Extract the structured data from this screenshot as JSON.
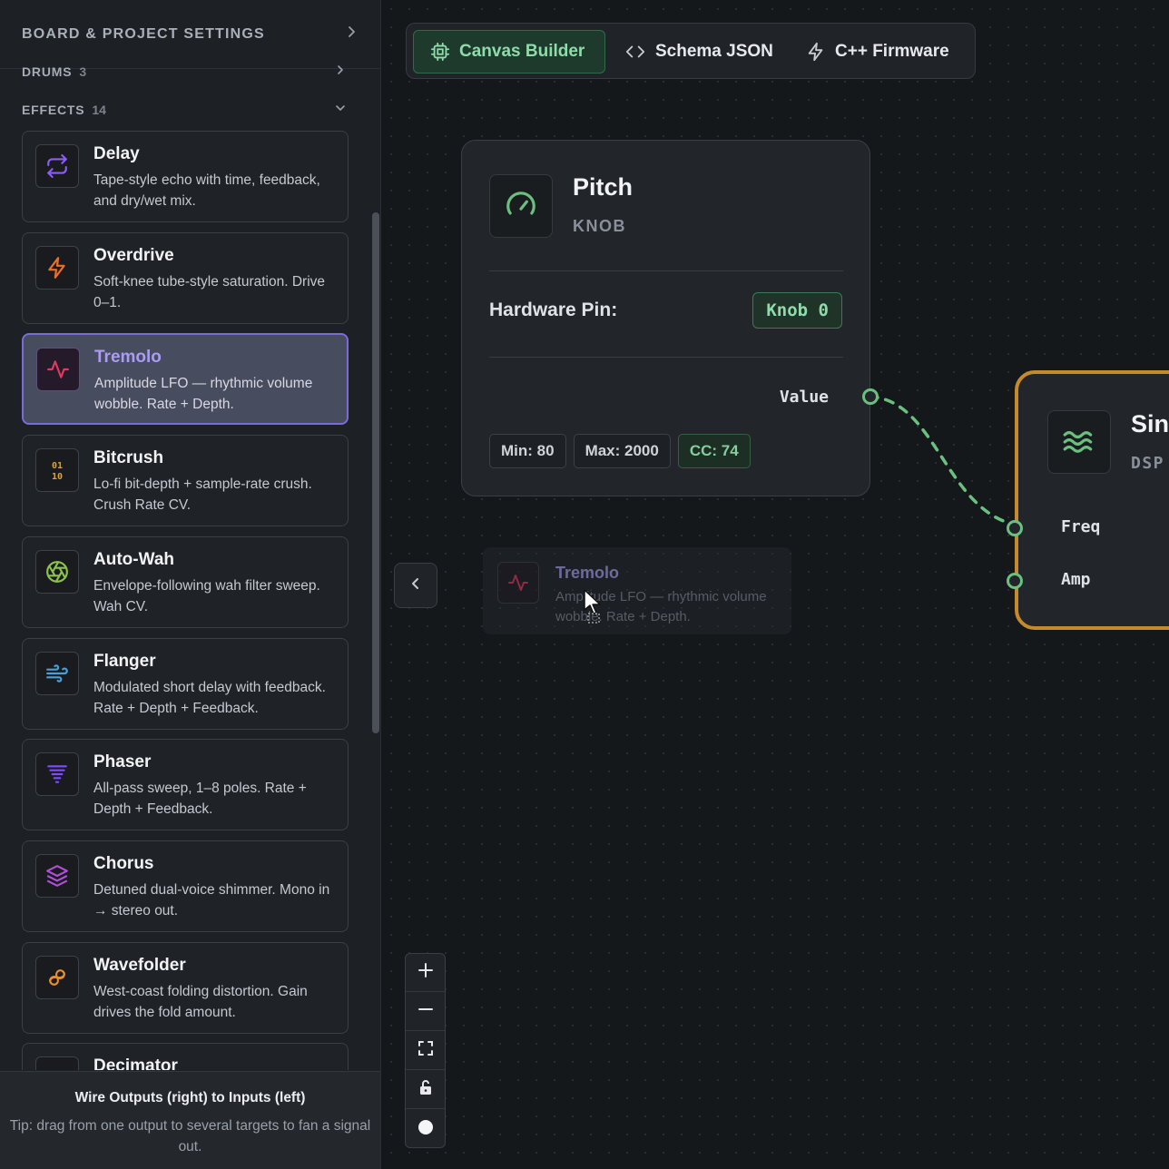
{
  "sidebar": {
    "header": {
      "title": "BOARD & PROJECT SETTINGS"
    },
    "categories": [
      {
        "label": "DRUMS",
        "count": "3"
      },
      {
        "label": "EFFECTS",
        "count": "14"
      }
    ],
    "modules": [
      {
        "name": "Delay",
        "desc": "Tape-style echo with time, feedback, and dry/wet mix.",
        "icon": "repeat-icon",
        "color": "#8b5cf6"
      },
      {
        "name": "Overdrive",
        "desc": "Soft-knee tube-style saturation. Drive 0–1.",
        "icon": "lightning-icon",
        "color": "#e8702a"
      },
      {
        "name": "Tremolo",
        "desc": "Amplitude LFO — rhythmic volume wobble. Rate + Depth.",
        "icon": "pulse-icon",
        "color": "#e23a5e"
      },
      {
        "name": "Bitcrush",
        "desc": "Lo-fi bit-depth + sample-rate crush. Crush Rate CV.",
        "icon": "binary-icon",
        "color": "#d9a43a"
      },
      {
        "name": "Auto-Wah",
        "desc": "Envelope-following wah filter sweep. Wah CV.",
        "icon": "aperture-icon",
        "color": "#8bc34a"
      },
      {
        "name": "Flanger",
        "desc": "Modulated short delay with feedback. Rate + Depth + Feedback.",
        "icon": "wind-icon",
        "color": "#4a9fd6"
      },
      {
        "name": "Phaser",
        "desc": "All-pass sweep, 1–8 poles. Rate + Depth + Feedback.",
        "icon": "filter-icon",
        "color": "#7c4dff"
      },
      {
        "name": "Chorus",
        "desc": "Detuned dual-voice shimmer. Mono in → stereo out.",
        "icon": "layers-icon",
        "color": "#b04fd8"
      },
      {
        "name": "Wavefolder",
        "desc": "West-coast folding distortion. Gain drives the fold amount.",
        "icon": "fold-icon",
        "color": "#e8902a"
      },
      {
        "name": "Decimator",
        "desc": "",
        "icon": "decimator-icon",
        "color": "#d99a3a"
      }
    ],
    "selected": "Tremolo",
    "tip": {
      "heading": "Wire Outputs (right) to Inputs (left)",
      "text": "Tip: drag from one output to several targets to fan a signal out."
    }
  },
  "tabs": [
    {
      "label": "Canvas Builder",
      "icon": "chip-icon",
      "active": true
    },
    {
      "label": "Schema JSON",
      "icon": "code-icon",
      "active": false
    },
    {
      "label": "C++ Firmware",
      "icon": "lightning-icon",
      "active": false
    }
  ],
  "knob_node": {
    "title": "Pitch",
    "kind": "KNOB",
    "hardware_pin_label": "Hardware Pin:",
    "hardware_pin": "Knob 0",
    "output": "Value",
    "min": "Min: 80",
    "max": "Max: 2000",
    "cc": "CC: 74"
  },
  "dsp_node": {
    "title": "Sine",
    "kind": "DSP",
    "inputs": [
      "Freq",
      "Amp"
    ]
  },
  "drag_ghost": {
    "name": "Tremolo",
    "desc": "Amplitude LFO — rhythmic volume wobble. Rate + Depth."
  },
  "colors": {
    "accent_green": "#6cc07f",
    "selected_border": "#7a6bd9",
    "dsp_border": "#c58a2c",
    "background": "#15181b"
  }
}
